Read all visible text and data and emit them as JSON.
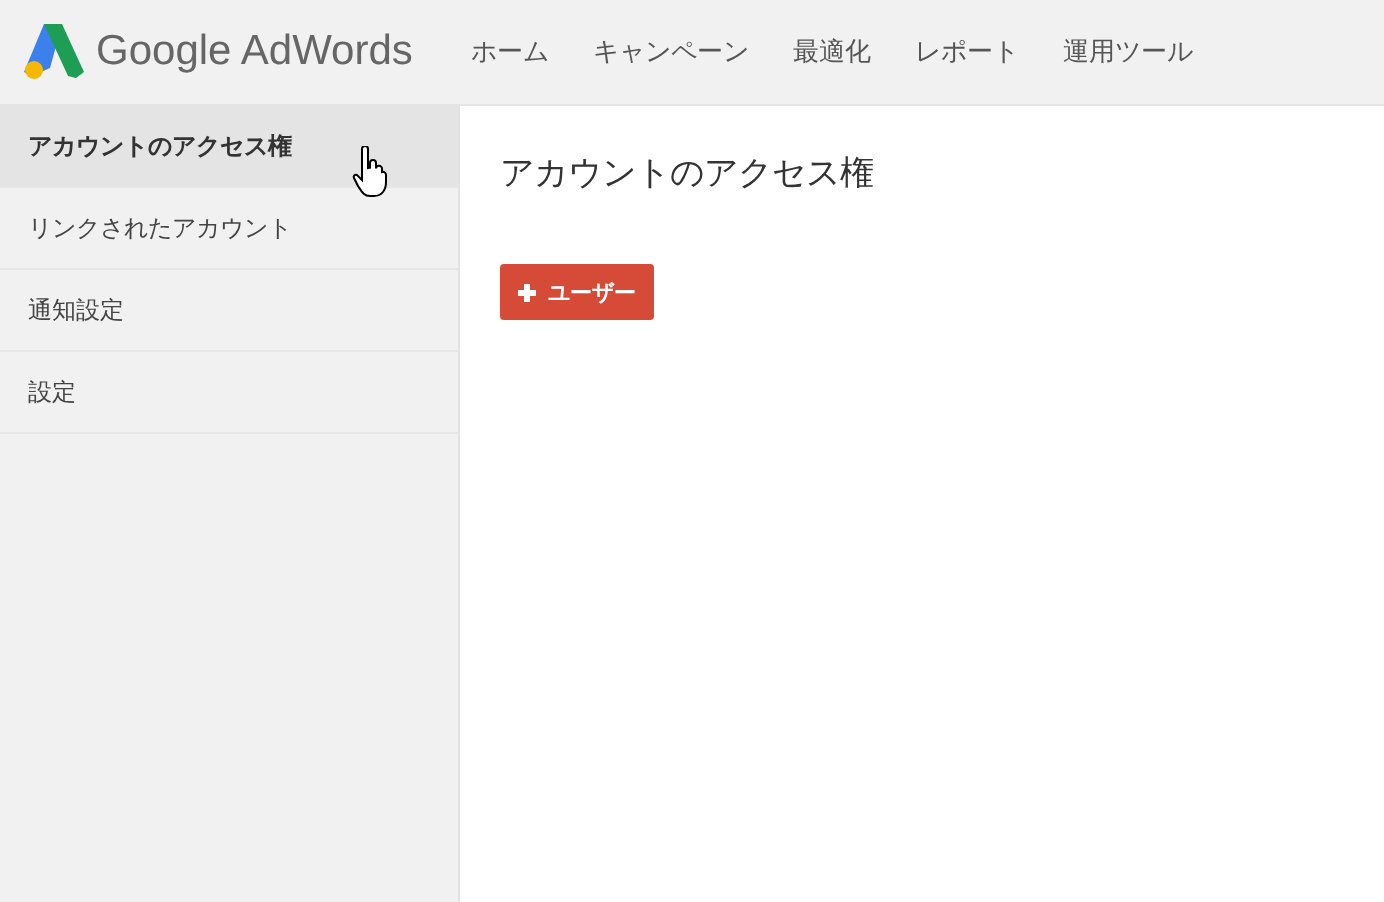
{
  "header": {
    "logo_text": "Google AdWords",
    "nav": [
      {
        "label": "ホーム"
      },
      {
        "label": "キャンペーン"
      },
      {
        "label": "最適化"
      },
      {
        "label": "レポート"
      },
      {
        "label": "運用ツール"
      }
    ]
  },
  "sidebar": {
    "items": [
      {
        "label": "アカウントのアクセス権",
        "selected": true
      },
      {
        "label": "リンクされたアカウント",
        "selected": false
      },
      {
        "label": "通知設定",
        "selected": false
      },
      {
        "label": "設定",
        "selected": false
      }
    ]
  },
  "main": {
    "title": "アカウントのアクセス権",
    "add_button": "ユーザー"
  }
}
